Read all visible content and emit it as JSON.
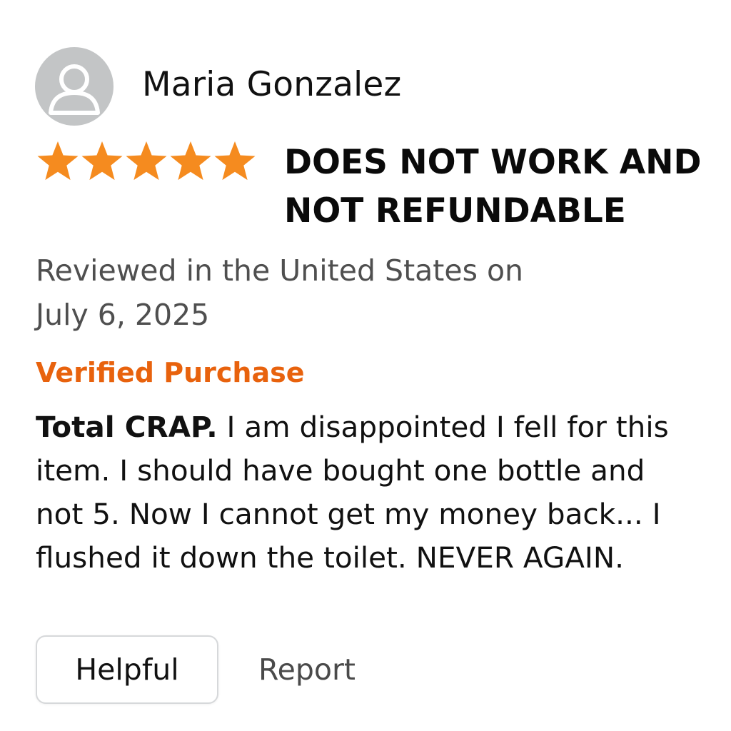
{
  "review": {
    "reviewer_name": "Maria Gonzalez",
    "avatar_icon": "default-user-icon",
    "rating": {
      "stars": 5,
      "max": 5,
      "icon": "star-icon",
      "color": "#f58b1f"
    },
    "title_line1": "DOES NOT WORK AND",
    "title_line2": "NOT REFUNDABLE",
    "meta_line1": "Reviewed in the United States on",
    "meta_line2": "July 6, 2025",
    "verified_label": "Verified Purchase",
    "verified_color": "#e8620d",
    "body_lead": "Total CRAP.",
    "body_text": " I am disappointed I fell for this item. I should have bought one bottle and not 5. Now I cannot get my money back... I flushed it down the toilet. NEVER AGAIN."
  },
  "actions": {
    "helpful_label": "Helpful",
    "report_label": "Report"
  }
}
